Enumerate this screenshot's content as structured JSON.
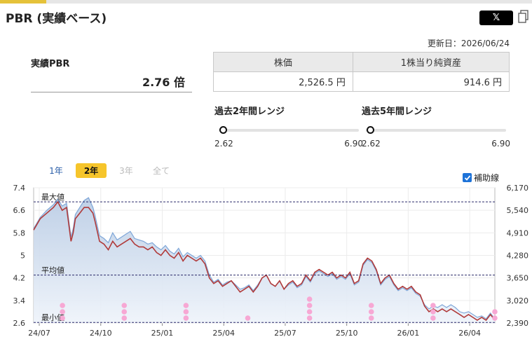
{
  "header": {
    "title": "PBR (実績ベース)",
    "share_x_label": "𝕏",
    "updated": "更新日：2026/06/24"
  },
  "pbr": {
    "label": "実績PBR",
    "value": "2.76 倍"
  },
  "prices": {
    "col1_header": "株価",
    "col2_header": "1株当り純資産",
    "col1_value": "2,526.5 円",
    "col2_value": "914.6 円"
  },
  "ranges": {
    "r2": {
      "label": "過去2年間レンジ",
      "min": "2.62",
      "max": "6.90",
      "current": 2.76,
      "min_val": 2.62,
      "max_val": 6.9
    },
    "r5": {
      "label": "過去5年間レンジ",
      "min": "2.62",
      "max": "6.90",
      "current": 2.76,
      "min_val": 2.62,
      "max_val": 6.9
    }
  },
  "tabs": {
    "t1": "1年",
    "t2": "2年",
    "t3": "3年",
    "t4": "全て"
  },
  "aux_label": "補助線",
  "chart_data": {
    "type": "line",
    "y_left_ticks": [
      "7.4",
      "6.6",
      "5.8",
      "5",
      "4.2",
      "3.4",
      "2.6"
    ],
    "y_right_ticks": [
      "6,170",
      "5,540",
      "4,910",
      "4,280",
      "3,650",
      "3,020",
      "2,390"
    ],
    "x_ticks": [
      "24/07",
      "24/10",
      "25/01",
      "25/04",
      "25/07",
      "25/10",
      "26/01",
      "26/04"
    ],
    "ylim_left": [
      2.6,
      7.4
    ],
    "ylim_right": [
      2390,
      6170
    ],
    "ref_lines": [
      {
        "label": "最大値",
        "value": 6.9
      },
      {
        "label": "平均値",
        "value": 4.3
      },
      {
        "label": "最小値",
        "value": 2.62
      }
    ],
    "pbr_series": [
      [
        0,
        5.9
      ],
      [
        3,
        6.3
      ],
      [
        6,
        6.5
      ],
      [
        9,
        6.7
      ],
      [
        11,
        6.9
      ],
      [
        13,
        6.6
      ],
      [
        15,
        6.7
      ],
      [
        17,
        5.5
      ],
      [
        18,
        5.8
      ],
      [
        19,
        6.3
      ],
      [
        21,
        6.5
      ],
      [
        23,
        6.7
      ],
      [
        25,
        6.7
      ],
      [
        27,
        6.5
      ],
      [
        28,
        6.2
      ],
      [
        30,
        5.5
      ],
      [
        32,
        5.4
      ],
      [
        34,
        5.2
      ],
      [
        36,
        5.5
      ],
      [
        38,
        5.3
      ],
      [
        40,
        5.4
      ],
      [
        42,
        5.5
      ],
      [
        44,
        5.6
      ],
      [
        46,
        5.4
      ],
      [
        48,
        5.3
      ],
      [
        50,
        5.3
      ],
      [
        52,
        5.2
      ],
      [
        54,
        5.3
      ],
      [
        56,
        5.1
      ],
      [
        58,
        5.0
      ],
      [
        60,
        5.2
      ],
      [
        62,
        5.0
      ],
      [
        64,
        4.9
      ],
      [
        66,
        5.1
      ],
      [
        68,
        4.8
      ],
      [
        70,
        5.0
      ],
      [
        72,
        4.9
      ],
      [
        74,
        4.8
      ],
      [
        76,
        4.9
      ],
      [
        78,
        4.7
      ],
      [
        80,
        4.2
      ],
      [
        82,
        4.0
      ],
      [
        84,
        4.1
      ],
      [
        86,
        3.9
      ],
      [
        88,
        4.0
      ],
      [
        90,
        4.1
      ],
      [
        92,
        3.9
      ],
      [
        94,
        3.7
      ],
      [
        96,
        3.8
      ],
      [
        98,
        3.9
      ],
      [
        100,
        3.7
      ],
      [
        102,
        3.9
      ],
      [
        104,
        4.2
      ],
      [
        106,
        4.3
      ],
      [
        108,
        4.0
      ],
      [
        110,
        3.9
      ],
      [
        112,
        4.1
      ],
      [
        114,
        3.8
      ],
      [
        116,
        4.0
      ],
      [
        118,
        4.1
      ],
      [
        120,
        3.9
      ],
      [
        122,
        4.0
      ],
      [
        124,
        4.3
      ],
      [
        126,
        4.1
      ],
      [
        128,
        4.4
      ],
      [
        130,
        4.5
      ],
      [
        132,
        4.4
      ],
      [
        134,
        4.3
      ],
      [
        136,
        4.4
      ],
      [
        138,
        4.2
      ],
      [
        140,
        4.3
      ],
      [
        142,
        4.2
      ],
      [
        144,
        4.4
      ],
      [
        146,
        4.0
      ],
      [
        148,
        4.1
      ],
      [
        150,
        4.7
      ],
      [
        152,
        4.9
      ],
      [
        154,
        4.8
      ],
      [
        156,
        4.5
      ],
      [
        158,
        4.0
      ],
      [
        160,
        4.2
      ],
      [
        162,
        4.3
      ],
      [
        164,
        4.0
      ],
      [
        166,
        3.8
      ],
      [
        168,
        3.9
      ],
      [
        170,
        3.8
      ],
      [
        172,
        3.9
      ],
      [
        174,
        3.7
      ],
      [
        176,
        3.6
      ],
      [
        178,
        3.2
      ],
      [
        180,
        3.0
      ],
      [
        182,
        3.1
      ],
      [
        184,
        3.0
      ],
      [
        186,
        3.1
      ],
      [
        188,
        3.0
      ],
      [
        190,
        3.1
      ],
      [
        192,
        3.0
      ],
      [
        194,
        2.9
      ],
      [
        196,
        2.8
      ],
      [
        198,
        2.9
      ],
      [
        200,
        2.8
      ],
      [
        202,
        2.7
      ],
      [
        204,
        2.8
      ],
      [
        206,
        2.7
      ],
      [
        208,
        2.9
      ],
      [
        210,
        2.7
      ]
    ],
    "price_series": [
      [
        0,
        5.95
      ],
      [
        3,
        6.35
      ],
      [
        6,
        6.6
      ],
      [
        9,
        6.8
      ],
      [
        11,
        7.0
      ],
      [
        13,
        6.75
      ],
      [
        15,
        6.85
      ],
      [
        17,
        5.65
      ],
      [
        18,
        5.95
      ],
      [
        19,
        6.45
      ],
      [
        21,
        6.7
      ],
      [
        23,
        6.95
      ],
      [
        25,
        7.05
      ],
      [
        27,
        6.7
      ],
      [
        28,
        6.4
      ],
      [
        30,
        5.7
      ],
      [
        32,
        5.6
      ],
      [
        34,
        5.45
      ],
      [
        36,
        5.8
      ],
      [
        38,
        5.55
      ],
      [
        40,
        5.65
      ],
      [
        42,
        5.75
      ],
      [
        44,
        5.85
      ],
      [
        46,
        5.6
      ],
      [
        48,
        5.55
      ],
      [
        50,
        5.5
      ],
      [
        52,
        5.4
      ],
      [
        54,
        5.45
      ],
      [
        56,
        5.3
      ],
      [
        58,
        5.2
      ],
      [
        60,
        5.35
      ],
      [
        62,
        5.15
      ],
      [
        64,
        5.05
      ],
      [
        66,
        5.25
      ],
      [
        68,
        4.95
      ],
      [
        70,
        5.1
      ],
      [
        72,
        5.0
      ],
      [
        74,
        4.9
      ],
      [
        76,
        5.0
      ],
      [
        78,
        4.8
      ],
      [
        80,
        4.3
      ],
      [
        82,
        4.05
      ],
      [
        84,
        4.15
      ],
      [
        86,
        3.95
      ],
      [
        88,
        4.05
      ],
      [
        90,
        4.1
      ],
      [
        92,
        3.95
      ],
      [
        94,
        3.8
      ],
      [
        96,
        3.85
      ],
      [
        98,
        3.95
      ],
      [
        100,
        3.75
      ],
      [
        102,
        3.95
      ],
      [
        104,
        4.2
      ],
      [
        106,
        4.3
      ],
      [
        108,
        4.0
      ],
      [
        110,
        3.9
      ],
      [
        112,
        4.1
      ],
      [
        114,
        3.8
      ],
      [
        116,
        3.95
      ],
      [
        118,
        4.05
      ],
      [
        120,
        3.85
      ],
      [
        122,
        3.95
      ],
      [
        124,
        4.25
      ],
      [
        126,
        4.05
      ],
      [
        128,
        4.35
      ],
      [
        130,
        4.45
      ],
      [
        132,
        4.35
      ],
      [
        134,
        4.25
      ],
      [
        136,
        4.35
      ],
      [
        138,
        4.15
      ],
      [
        140,
        4.25
      ],
      [
        142,
        4.15
      ],
      [
        144,
        4.35
      ],
      [
        146,
        3.95
      ],
      [
        148,
        4.05
      ],
      [
        150,
        4.65
      ],
      [
        152,
        4.85
      ],
      [
        154,
        4.75
      ],
      [
        156,
        4.45
      ],
      [
        158,
        3.95
      ],
      [
        160,
        4.15
      ],
      [
        162,
        4.25
      ],
      [
        164,
        3.95
      ],
      [
        166,
        3.75
      ],
      [
        168,
        3.85
      ],
      [
        170,
        3.75
      ],
      [
        172,
        3.85
      ],
      [
        174,
        3.65
      ],
      [
        176,
        3.55
      ],
      [
        178,
        3.25
      ],
      [
        180,
        3.1
      ],
      [
        182,
        3.2
      ],
      [
        184,
        3.15
      ],
      [
        186,
        3.25
      ],
      [
        188,
        3.15
      ],
      [
        190,
        3.25
      ],
      [
        192,
        3.15
      ],
      [
        194,
        3.0
      ],
      [
        196,
        2.95
      ],
      [
        198,
        3.0
      ],
      [
        200,
        2.9
      ],
      [
        202,
        2.8
      ],
      [
        204,
        2.85
      ],
      [
        206,
        2.75
      ],
      [
        208,
        2.95
      ],
      [
        210,
        2.75
      ]
    ],
    "event_markers": [
      {
        "x": 14,
        "count": 3
      },
      {
        "x": 44,
        "count": 3
      },
      {
        "x": 74,
        "count": 3
      },
      {
        "x": 104,
        "count": 1
      },
      {
        "x": 134,
        "count": 4
      },
      {
        "x": 164,
        "count": 3
      },
      {
        "x": 194,
        "count": 3
      },
      {
        "x": 224,
        "count": 2
      }
    ]
  }
}
